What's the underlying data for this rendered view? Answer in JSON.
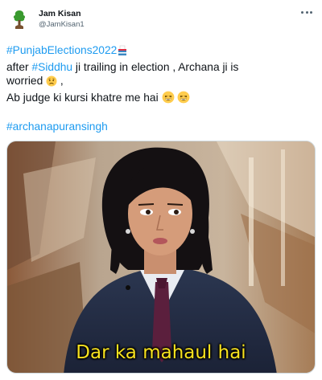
{
  "author": {
    "name": "Jam Kisan",
    "handle": "@JamKisan1"
  },
  "tweet": {
    "hashtag_1": "#PunjabElections2022",
    "line2_prefix": "after ",
    "hashtag_2": "#Siddhu",
    "line2_suffix": " ji trailing in election , Archana ji is",
    "line3": "worried",
    "line3_suffix": " ,",
    "line4": "Ab judge ki kursi khatre me hai",
    "hashtag_3": "#archanapuransingh"
  },
  "media": {
    "caption": "Dar ka mahaul hai"
  },
  "icons": {
    "more": "more-options-icon",
    "ballot": "ballot-box-emoji",
    "worried": "worried-face-emoji",
    "grin": "grinning-squinting-face-emoji"
  },
  "colors": {
    "link": "#1d9bf0",
    "text": "#0f1419",
    "secondary": "#536471",
    "caption": "#f7e21f"
  }
}
